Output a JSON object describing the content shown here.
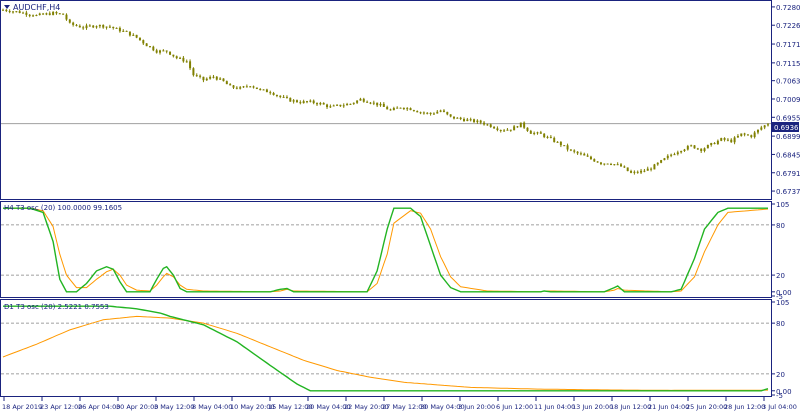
{
  "main": {
    "symbol_title": "AUDCHF,H4",
    "current_price": "0.69362",
    "price_ticks": [
      "0.72805",
      "0.72265",
      "0.71710",
      "0.71155",
      "0.70630",
      "0.70090",
      "0.69550",
      "0.68995",
      "0.68455",
      "0.67915",
      "0.67375"
    ],
    "ylim": [
      0.672,
      0.7292
    ]
  },
  "h4_panel": {
    "title": "H4 T3 osc (20) 100.0000 99.1605",
    "ticks": [
      "105",
      "80",
      "20",
      "0.00",
      "-5"
    ],
    "ylim": [
      -5,
      105
    ],
    "levels": [
      80,
      20
    ]
  },
  "d1_panel": {
    "title": "D1 T3 osc (20) 2.5221 0.7553",
    "ticks": [
      "105",
      "80",
      "20",
      "0.00",
      "-5"
    ],
    "ylim": [
      -5,
      105
    ],
    "levels": [
      80,
      20
    ]
  },
  "x_axis": {
    "labels": [
      "18 Apr 2019",
      "23 Apr 12:00",
      "26 Apr 04:00",
      "30 Apr 20:00",
      "3 May 12:00",
      "8 May 04:00",
      "10 May 20:00",
      "15 May 12:00",
      "20 May 04:00",
      "22 May 20:00",
      "27 May 12:00",
      "30 May 04:00",
      "3 Jun 20:00",
      "6 Jun 12:00",
      "11 Jun 04:00",
      "13 Jun 20:00",
      "18 Jun 12:00",
      "21 Jun 04:00",
      "25 Jun 20:00",
      "28 Jun 12:00",
      "3 Jul 04:00"
    ]
  },
  "colors": {
    "candles": "#808000",
    "background": "#ffffff",
    "frame": "#1a237e",
    "price_line": "#a0a0a0",
    "price_label_bg": "#1a237e",
    "green_line": "#22b422",
    "orange_line": "#ff9900",
    "level_line": "#808080"
  },
  "chart_data": [
    {
      "type": "candlestick",
      "title": "AUDCHF,H4",
      "close_path": [
        [
          0,
          0.7272
        ],
        [
          5,
          0.7265
        ],
        [
          10,
          0.7255
        ],
        [
          15,
          0.7262
        ],
        [
          18,
          0.7258
        ],
        [
          20,
          0.723
        ],
        [
          24,
          0.722
        ],
        [
          28,
          0.7226
        ],
        [
          32,
          0.7222
        ],
        [
          34,
          0.7215
        ],
        [
          37,
          0.7205
        ],
        [
          40,
          0.719
        ],
        [
          43,
          0.7168
        ],
        [
          46,
          0.715
        ],
        [
          49,
          0.715
        ],
        [
          52,
          0.713
        ],
        [
          55,
          0.712
        ],
        [
          57,
          0.708
        ],
        [
          60,
          0.7065
        ],
        [
          63,
          0.7075
        ],
        [
          66,
          0.706
        ],
        [
          68,
          0.7045
        ],
        [
          71,
          0.704
        ],
        [
          74,
          0.705
        ],
        [
          77,
          0.7035
        ],
        [
          80,
          0.703
        ],
        [
          83,
          0.7015
        ],
        [
          86,
          0.7005
        ],
        [
          89,
          0.7
        ],
        [
          92,
          0.7
        ],
        [
          95,
          0.6995
        ],
        [
          98,
          0.6985
        ],
        [
          101,
          0.699
        ],
        [
          104,
          0.6995
        ],
        [
          107,
          0.7008
        ],
        [
          110,
          0.7
        ],
        [
          113,
          0.699
        ],
        [
          116,
          0.6975
        ],
        [
          119,
          0.6985
        ],
        [
          122,
          0.698
        ],
        [
          125,
          0.697
        ],
        [
          128,
          0.6965
        ],
        [
          131,
          0.6975
        ],
        [
          134,
          0.6955
        ],
        [
          137,
          0.695
        ],
        [
          140,
          0.6945
        ],
        [
          143,
          0.694
        ],
        [
          146,
          0.693
        ],
        [
          149,
          0.6918
        ],
        [
          152,
          0.692
        ],
        [
          155,
          0.6935
        ],
        [
          158,
          0.691
        ],
        [
          161,
          0.6905
        ],
        [
          164,
          0.689
        ],
        [
          167,
          0.6875
        ],
        [
          170,
          0.6855
        ],
        [
          173,
          0.6845
        ],
        [
          176,
          0.6832
        ],
        [
          179,
          0.682
        ],
        [
          182,
          0.682
        ],
        [
          185,
          0.681
        ],
        [
          188,
          0.679
        ],
        [
          191,
          0.6795
        ],
        [
          194,
          0.6805
        ],
        [
          197,
          0.6825
        ],
        [
          200,
          0.6845
        ],
        [
          203,
          0.686
        ],
        [
          206,
          0.687
        ],
        [
          209,
          0.686
        ],
        [
          212,
          0.6875
        ],
        [
          215,
          0.689
        ],
        [
          218,
          0.6885
        ],
        [
          221,
          0.6905
        ],
        [
          224,
          0.69
        ],
        [
          227,
          0.6925
        ],
        [
          229,
          0.6936
        ]
      ],
      "last_price": 0.69362,
      "ylim": [
        0.672,
        0.7292
      ]
    },
    {
      "type": "line",
      "title": "H4 T3 osc (20) 100.0000 99.1605",
      "ylim": [
        -5,
        105
      ],
      "series": [
        {
          "color": "#22b422",
          "points": [
            [
              0,
              100
            ],
            [
              8,
              100
            ],
            [
              12,
              95
            ],
            [
              15,
              60
            ],
            [
              17,
              15
            ],
            [
              19,
              0
            ],
            [
              22,
              0
            ],
            [
              25,
              10
            ],
            [
              28,
              25
            ],
            [
              31,
              30
            ],
            [
              33,
              27
            ],
            [
              35,
              12
            ],
            [
              37,
              0
            ],
            [
              40,
              0
            ],
            [
              44,
              0
            ],
            [
              46,
              15
            ],
            [
              48,
              28
            ],
            [
              49,
              30
            ],
            [
              51,
              20
            ],
            [
              53,
              4
            ],
            [
              55,
              0
            ],
            [
              80,
              0
            ],
            [
              83,
              3
            ],
            [
              85,
              4
            ],
            [
              87,
              0
            ],
            [
              109,
              0
            ],
            [
              112,
              25
            ],
            [
              115,
              75
            ],
            [
              117,
              100
            ],
            [
              122,
              100
            ],
            [
              125,
              90
            ],
            [
              128,
              55
            ],
            [
              131,
              20
            ],
            [
              134,
              5
            ],
            [
              137,
              0
            ],
            [
              150,
              0
            ],
            [
              161,
              0
            ],
            [
              162,
              1
            ],
            [
              164,
              0
            ],
            [
              180,
              0
            ],
            [
              183,
              5
            ],
            [
              184,
              7
            ],
            [
              186,
              0
            ],
            [
              200,
              0
            ],
            [
              203,
              3
            ],
            [
              207,
              40
            ],
            [
              210,
              75
            ],
            [
              214,
              95
            ],
            [
              217,
              100
            ],
            [
              229,
              100
            ]
          ]
        },
        {
          "color": "#ff9900",
          "points": [
            [
              0,
              100
            ],
            [
              8,
              100
            ],
            [
              12,
              97
            ],
            [
              15,
              78
            ],
            [
              17,
              45
            ],
            [
              19,
              20
            ],
            [
              22,
              5
            ],
            [
              25,
              5
            ],
            [
              28,
              15
            ],
            [
              31,
              24
            ],
            [
              33,
              27
            ],
            [
              35,
              20
            ],
            [
              37,
              8
            ],
            [
              40,
              2
            ],
            [
              44,
              1
            ],
            [
              46,
              8
            ],
            [
              48,
              18
            ],
            [
              49,
              22
            ],
            [
              51,
              18
            ],
            [
              53,
              8
            ],
            [
              55,
              3
            ],
            [
              60,
              1
            ],
            [
              80,
              0
            ],
            [
              83,
              1
            ],
            [
              85,
              3
            ],
            [
              87,
              1
            ],
            [
              109,
              0
            ],
            [
              112,
              10
            ],
            [
              115,
              45
            ],
            [
              117,
              82
            ],
            [
              122,
              97
            ],
            [
              125,
              94
            ],
            [
              128,
              75
            ],
            [
              131,
              42
            ],
            [
              134,
              18
            ],
            [
              137,
              6
            ],
            [
              145,
              1
            ],
            [
              161,
              0
            ],
            [
              162,
              1
            ],
            [
              164,
              1
            ],
            [
              180,
              0
            ],
            [
              183,
              2
            ],
            [
              184,
              4
            ],
            [
              186,
              2
            ],
            [
              200,
              0
            ],
            [
              203,
              1
            ],
            [
              207,
              18
            ],
            [
              210,
              48
            ],
            [
              214,
              80
            ],
            [
              217,
              95
            ],
            [
              229,
              99
            ]
          ]
        }
      ]
    },
    {
      "type": "line",
      "title": "D1 T3 osc (20) 2.5221 0.7553",
      "ylim": [
        -5,
        105
      ],
      "series": [
        {
          "color": "#22b422",
          "points": [
            [
              0,
              100
            ],
            [
              25,
              100
            ],
            [
              32,
              100
            ],
            [
              40,
              97
            ],
            [
              47,
              92
            ],
            [
              50,
              88
            ],
            [
              60,
              78
            ],
            [
              70,
              58
            ],
            [
              80,
              30
            ],
            [
              88,
              8
            ],
            [
              92,
              0
            ],
            [
              180,
              0
            ],
            [
              227,
              0
            ],
            [
              229,
              2.5
            ]
          ]
        },
        {
          "color": "#ff9900",
          "points": [
            [
              0,
              40
            ],
            [
              10,
              55
            ],
            [
              20,
              72
            ],
            [
              30,
              84
            ],
            [
              40,
              88
            ],
            [
              50,
              86
            ],
            [
              60,
              80
            ],
            [
              70,
              68
            ],
            [
              80,
              52
            ],
            [
              90,
              36
            ],
            [
              100,
              24
            ],
            [
              110,
              16
            ],
            [
              120,
              10
            ],
            [
              130,
              7
            ],
            [
              140,
              4
            ],
            [
              150,
              3
            ],
            [
              160,
              2
            ],
            [
              180,
              1
            ],
            [
              200,
              0.5
            ],
            [
              229,
              0.75
            ]
          ]
        }
      ]
    }
  ]
}
